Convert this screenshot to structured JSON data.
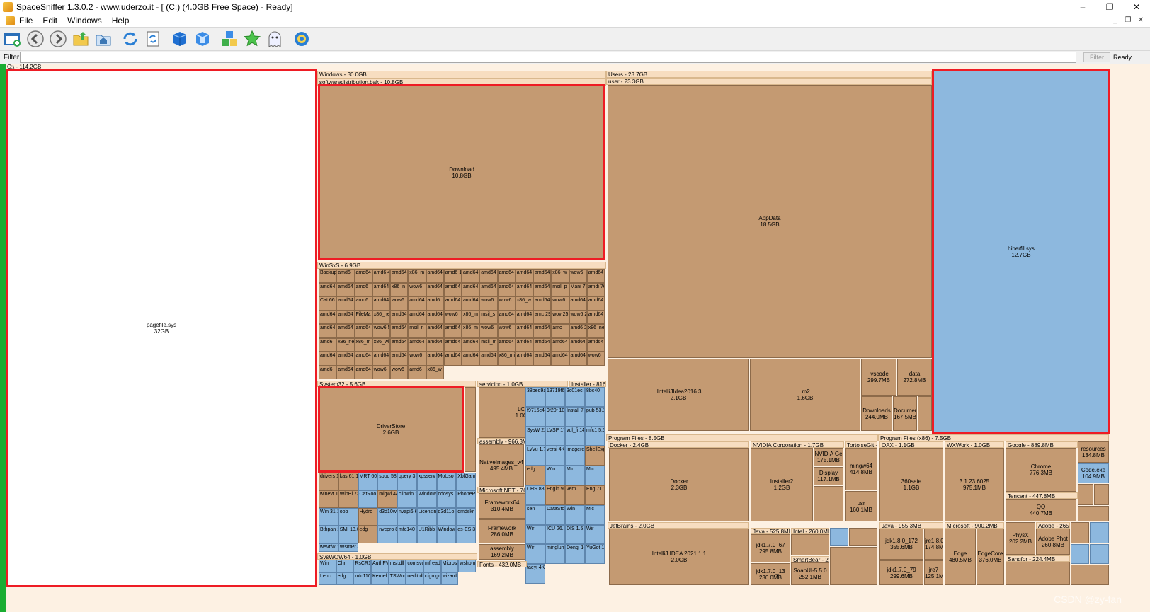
{
  "window": {
    "title": "SpaceSniffer 1.3.0.2 - www.uderzo.it - [ (C:) (4.0GB Free Space) - Ready]",
    "minimize": "–",
    "restore": "❐",
    "close": "✕"
  },
  "menu": {
    "items": [
      "File",
      "Edit",
      "Windows",
      "Help"
    ],
    "mdi_min": "_",
    "mdi_restore": "❐",
    "mdi_close": "✕"
  },
  "toolbar": {
    "icons": [
      "new-scan-icon",
      "back-icon",
      "forward-icon",
      "parent-folder-icon",
      "home-icon",
      "refresh-icon",
      "rescan-icon",
      "zoom-in-icon",
      "zoom-out-icon",
      "tags-icon",
      "favorite-icon",
      "ghost-icon",
      "settings-icon"
    ]
  },
  "filter": {
    "label": "Filter",
    "value": "",
    "button": "Filter",
    "status": "Ready"
  },
  "colors": {
    "folder": "#c49a72",
    "file": "#8db8de",
    "header": "#f7ddc0",
    "highlight": "#ee1c24",
    "drive_bar": "#1aad32"
  },
  "root": {
    "label": "C:\\ - 114.2GB"
  },
  "blocks": {
    "pagefile": {
      "name": "pagefile.sys",
      "size": "32GB"
    },
    "windows_hdr": "Windows - 30.0GB",
    "swdist_hdr": "softwaredistribution.bak - 10.8GB",
    "download": {
      "name": "Download",
      "size": "10.8GB"
    },
    "winsxs_hdr": "WinSxS - 6.9GB",
    "system32_hdr": "System32 - 5.6GB",
    "driverstore": {
      "name": "DriverStore",
      "size": "2.6GB"
    },
    "servicing_hdr": "servicing - 1.0GB",
    "lcu": {
      "name": "LCU",
      "size": "1.0GB"
    },
    "installer_hdr": "Installer - 816.",
    "assembly_hdr": "assembly - 966.3MB",
    "nativeimages": {
      "name": "NativeImages_v4",
      "size": "495.4MB"
    },
    "msnet_hdr": "Microsoft.NET - 76",
    "framework64": {
      "name": "Framework64",
      "size": "310.4MB"
    },
    "framework": {
      "name": "Framework",
      "size": "286.0MB"
    },
    "assembly2": {
      "name": "assembly",
      "size": "169.2MB"
    },
    "syswow_hdr": "SysWOW64 - 1.0GB",
    "fonts_hdr": "Fonts - 432.0MB",
    "users_hdr": "Users - 23.7GB",
    "user_hdr": "user - 23.3GB",
    "appdata": {
      "name": "AppData",
      "size": "18.5GB"
    },
    "intellij2016": {
      "name": ".IntelliJIdea2016.3",
      "size": "2.1GB"
    },
    "m2": {
      "name": ".m2",
      "size": "1.6GB"
    },
    "vscode": {
      "name": ".vscode",
      "size": "299.7MB"
    },
    "data": {
      "name": "data",
      "size": "272.8MB"
    },
    "downloads": {
      "name": "Downloads",
      "size": "244.0MB"
    },
    "documents": {
      "name": "Documen",
      "size": "167.5MB"
    },
    "hiberfil": {
      "name": "hiberfil.sys",
      "size": "12.7GB"
    },
    "progfiles_hdr": "Program Files - 8.5GB",
    "docker_hdr": "Docker - 2.4GB",
    "docker": {
      "name": "Docker",
      "size": "2.3GB"
    },
    "nvidia_hdr": "NVIDIA Corporation - 1.7GB",
    "installer2": {
      "name": "Installer2",
      "size": "1.2GB"
    },
    "nvgfx": {
      "name": "NVIDIA Ge",
      "size": "175.1MB"
    },
    "display": {
      "name": "Display",
      "size": "117.1MB"
    },
    "tortoise_hdr": "TortoiseGit -",
    "mingw": {
      "name": "mingw64",
      "size": "414.8MB"
    },
    "usr": {
      "name": "usr",
      "size": "160.1MB"
    },
    "jetbrains_hdr": "JetBrains - 2.0GB",
    "idea2021": {
      "name": "IntelliJ IDEA 2021.1.1",
      "size": "2.0GB"
    },
    "java_hdr": "Java - 525.8MB",
    "jdk170_67": {
      "name": "jdk1.7.0_67",
      "size": "295.8MB"
    },
    "jdk170_13": {
      "name": "jdk1.7.0_13",
      "size": "230.0MB"
    },
    "intel_hdr": "Intel - 260.0MB",
    "smartbear": {
      "name": "SmartBear - 2",
      "size": ""
    },
    "soapui": {
      "name": "SoapUI-5.5.0",
      "size": "252.1MB"
    },
    "pfx86_hdr": "Program Files (x86) - 7.5GB",
    "qax_hdr": "QAX - 1.1GB",
    "safe360": {
      "name": "360safe",
      "size": "1.1GB"
    },
    "wxwork_hdr": "WXWork - 1.0GB",
    "wx31": {
      "name": "3.1.23.6025",
      "size": "975.1MB"
    },
    "google_hdr": "Google - 889.8MB",
    "chrome": {
      "name": "Chrome",
      "size": "776.3MB"
    },
    "tencent_hdr": "Tencent - 447.8MB",
    "qq": {
      "name": "QQ",
      "size": "440.7MB"
    },
    "resources": {
      "name": "resources",
      "size": "134.8MB"
    },
    "codeexe": {
      "name": "Code.exe",
      "size": "104.9MB"
    },
    "java2_hdr": "Java - 955.3MB",
    "jdk180_172": {
      "name": "jdk1.8.0_172",
      "size": "355.6MB"
    },
    "jre18": {
      "name": "jre1.8.0",
      "size": "174.8M"
    },
    "jdk170_79": {
      "name": "jdk1.7.0_79",
      "size": "299.6MB"
    },
    "jre7": {
      "name": "jre7",
      "size": "125.1M"
    },
    "microsoft_hdr": "Microsoft - 900.2MB",
    "edge": {
      "name": "Edge",
      "size": "480.5MB"
    },
    "edgecore": {
      "name": "EdgeCore",
      "size": "376.0MB"
    },
    "physx": {
      "name": "PhysX",
      "size": "202.2MB"
    },
    "adobe_hdr": "Adobe - 265",
    "adobephot": {
      "name": "Adobe Phot",
      "size": "260.8MB"
    },
    "sangfor_hdr": "Sangfor - 224.4MB",
    "watermark": "CSDN @zy-fan"
  },
  "winsxs_cells": [
    "Backup 161.3MB",
    "amd6",
    "amd64 65.9MB",
    "amd6 48.5M",
    "amd64 16.2MB",
    "x86_m 14.9M",
    "amd64 12.8MB",
    "amd6 11.1M",
    "amd64",
    "amd64 3.9MB",
    "amd64 3.1MB",
    "amd64",
    "amd64",
    "x86_w",
    "wow6",
    "amd64",
    "amd64",
    "amd64",
    "amd6",
    "amd64",
    "x86_n",
    "wow6",
    "amd64",
    "amd64",
    "amd64",
    "amd64",
    "amd64",
    "amd64",
    "amd64",
    "msil_p",
    "Mani 77.1",
    "amdi 76.1",
    "Cat 66.4",
    "amd64 43.4M",
    "amd6",
    "amd64",
    "wow6",
    "amd64 10.7M",
    "amd6",
    "amd64 3.6MB",
    "amd64",
    "wow6",
    "wow6",
    "x86_w",
    "amd64",
    "wow6",
    "amd64",
    "amd64",
    "amd64",
    "amd64",
    "FileMa",
    "x86_ne",
    "amd64",
    "amd64",
    "amd64",
    "wow6",
    "x86_m",
    "msil_s",
    "amd64",
    "amd64",
    "amc 29.9",
    "wov 25.5M",
    "wow6 21.9M",
    "amd64 19.4M",
    "amd64",
    "amd64",
    "amd64",
    "wow6 5.5MB",
    "amd64",
    "msil_n",
    "amd64",
    "amd64",
    "x86_m",
    "wow6",
    "wow6",
    "amd64",
    "amd64",
    "amc",
    "amd6 24.4M",
    "x86_ne",
    "amd6",
    "x86_ne",
    "x86_m",
    "x86_wi",
    "amd64",
    "amd64",
    "amd64",
    "amd64",
    "amd64",
    "msil_m",
    "amd64",
    "amd64",
    "amd64",
    "amd64",
    "amd64",
    "amd64",
    "amd64",
    "amd64",
    "amd64 4.9MB",
    "amd64",
    "amd64",
    "wow6",
    "amd64",
    "amd64",
    "amd64",
    "amd64",
    "x86_mi",
    "amd64",
    "amd64",
    "amd64",
    "amd64",
    "wow6",
    "amd6",
    "amd64",
    "amd64",
    "wow6",
    "wow6",
    "amd6",
    "x86_w"
  ],
  "system32_cells": [
    "drivers 197.6MB",
    "kas 61.1",
    "MRT 60.2",
    "spoc 58.4",
    "query 3.1MB",
    "xpsserv 2.7MB",
    "MoUso 1.4MB",
    "XblGam 1.2MB",
    "winevt 114.7MB",
    "WinBi 73.3M",
    "CatRoo 45.4MB",
    "migwi 44.9M",
    "clipwin 1.9MB",
    "Window 1.8MB",
    "cdosys 1.0MB",
    "PhoneP 872KB",
    "Win 31.1",
    "oob",
    "Hydro",
    "d3d10w 6.9MB",
    "nvapi6 6.6MB",
    "Licensin 732KB",
    "d3d11o 592KB",
    "dmdskr 276KB",
    "Bthpan 188KB",
    "SMI 13.0M",
    "edg",
    "nvcpro 8.9MB",
    "mfc140 5.5MB",
    "U1Ribb 3.8MB",
    "Window 472KB",
    "es-ES 368KB",
    "wevtfw 104KB",
    "WsmPr 4KB"
  ],
  "syswow_cells": [
    "Win",
    "Chr",
    "RsCR1",
    "AuthFV",
    "msi.dll",
    "comsvc",
    "mfread",
    "Microso",
    "wshom",
    "Lenc",
    "edg",
    "mfc110",
    "Kernel",
    "TSWork",
    "oedit.dl",
    "cfgmgr",
    "wizard"
  ],
  "installer_cells": [
    "38bed9a7.msi 208.1MB",
    "13719f6e.msi 199.5MB",
    "3c01ec 56.5MB",
    "8bc40",
    "f9716c4 20.4MB",
    "9f20f 10.1",
    "Install 77.2M",
    "pub 53.1",
    "SysW 22.2",
    "LVSP 17.4",
    "vul_fi 14.9M",
    "mfc1 5.5M",
    "LvVu 1.7M",
    "versi 4KB",
    "imagere",
    "ShellExp",
    "edg",
    "Win",
    "Mic",
    "Mic",
    "CHS 88.1",
    "Engin 92.9",
    "vem",
    "Eng 71.1",
    "sen",
    "DataSto",
    "Win",
    "Mic",
    "Wir",
    "ICU 26.2",
    "DIS 1.5",
    "Wir",
    "Wir",
    "mingluh 35.0MB",
    "Dengl 14.4M",
    "YuGot 13.0M",
    "taeyi 4KB"
  ]
}
